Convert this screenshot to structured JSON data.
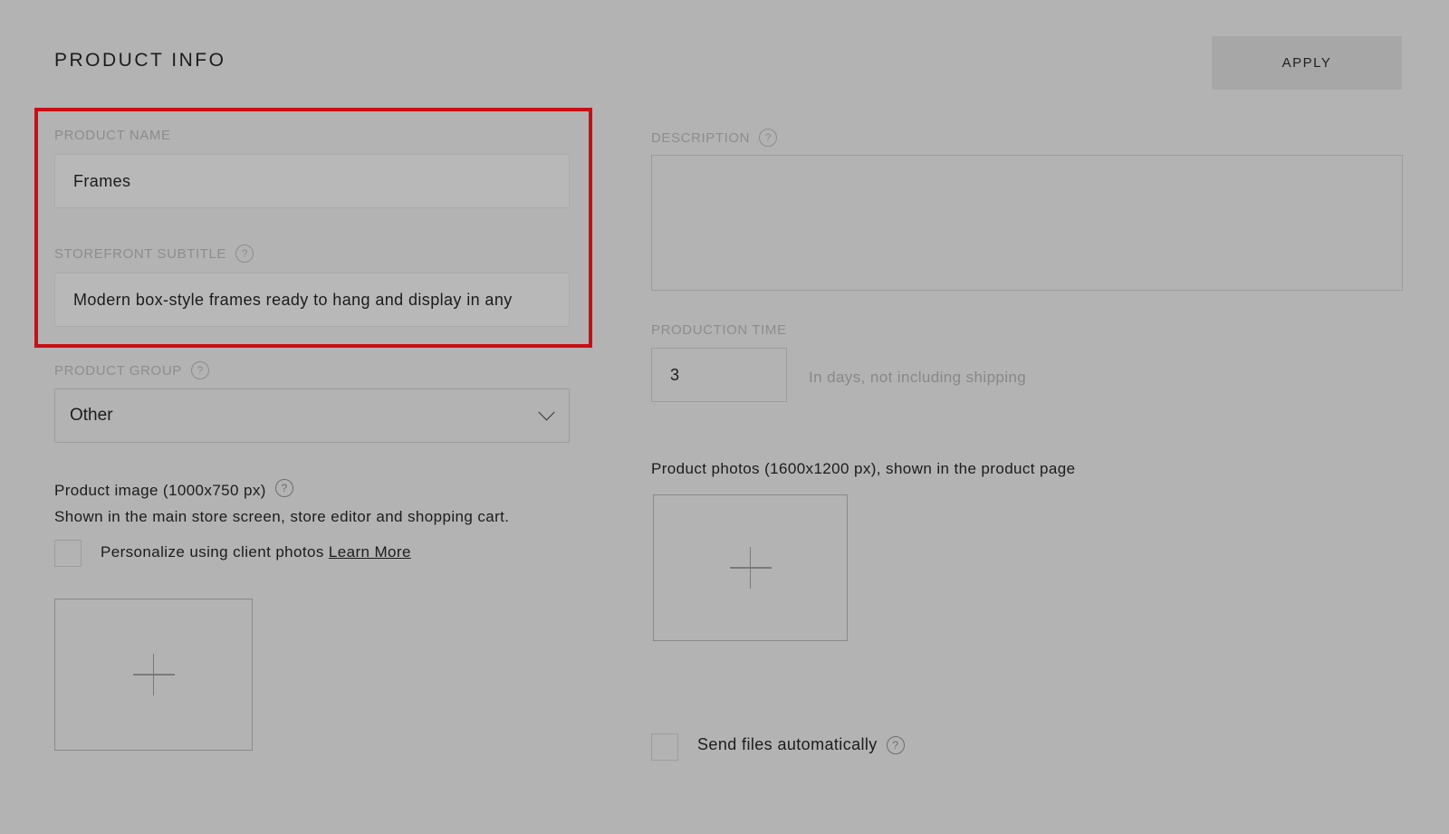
{
  "header": {
    "title": "PRODUCT INFO",
    "apply_label": "APPLY"
  },
  "product_name": {
    "label": "PRODUCT NAME",
    "value": "Frames"
  },
  "storefront_subtitle": {
    "label": "STOREFRONT SUBTITLE",
    "value": "Modern box-style frames ready to hang and display in any"
  },
  "product_group": {
    "label": "PRODUCT GROUP",
    "selected": "Other"
  },
  "product_image": {
    "title": "Product image (1000x750 px)",
    "description": "Shown in the main store screen, store editor and shopping cart.",
    "personalize_label": "Personalize using client photos",
    "learn_more": "Learn More"
  },
  "description": {
    "label": "DESCRIPTION",
    "value": ""
  },
  "production_time": {
    "label": "PRODUCTION TIME",
    "value": "3",
    "hint": "In days, not including shipping"
  },
  "product_photos": {
    "title": "Product photos (1600x1200 px), shown in the product page"
  },
  "send_files": {
    "label": "Send files automatically"
  },
  "help_glyph": "?",
  "colors": {
    "background": "#b3b3b3",
    "highlight": "#c80f16"
  }
}
